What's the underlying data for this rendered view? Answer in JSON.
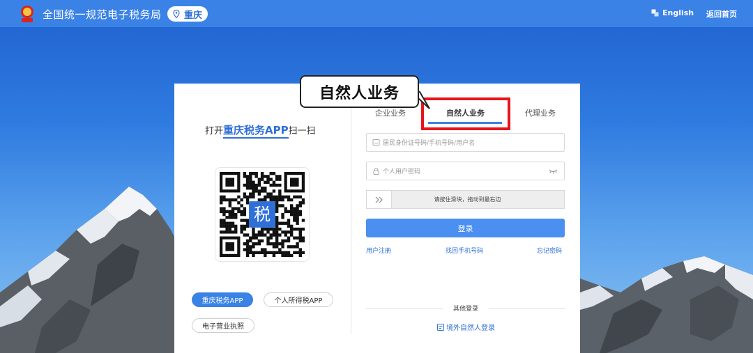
{
  "header": {
    "site_title": "全国统一规范电子税务局",
    "city": "重庆",
    "lang_label": "English",
    "home_label": "返回首页"
  },
  "left_panel": {
    "scan_prefix": "打开",
    "scan_app": "重庆税务APP",
    "scan_suffix": "扫一扫",
    "qr_center_char": "税",
    "app_buttons": [
      {
        "label": "重庆税务APP",
        "active": true
      },
      {
        "label": "个人所得税APP",
        "active": false
      },
      {
        "label": "电子营业执照",
        "active": false
      }
    ]
  },
  "right_panel": {
    "tabs": [
      {
        "label": "企业业务"
      },
      {
        "label": "自然人业务",
        "selected": true
      },
      {
        "label": "代理业务"
      }
    ],
    "username_placeholder": "居民身份证号码/手机号码/用户名",
    "password_placeholder": "个人用户密码",
    "slider_hint": "请按住滑块，拖动到最右边",
    "login_label": "登录",
    "links": {
      "register": "用户注册",
      "find_phone": "找回手机号码",
      "forgot": "忘记密码"
    },
    "other_login_title": "其他登录",
    "overseas_login": "境外自然人登录"
  },
  "callout": {
    "text": "自然人业务"
  },
  "colors": {
    "primary": "#3a82e6",
    "highlight_red": "#e8141c",
    "link_blue": "#2f6fd8"
  }
}
